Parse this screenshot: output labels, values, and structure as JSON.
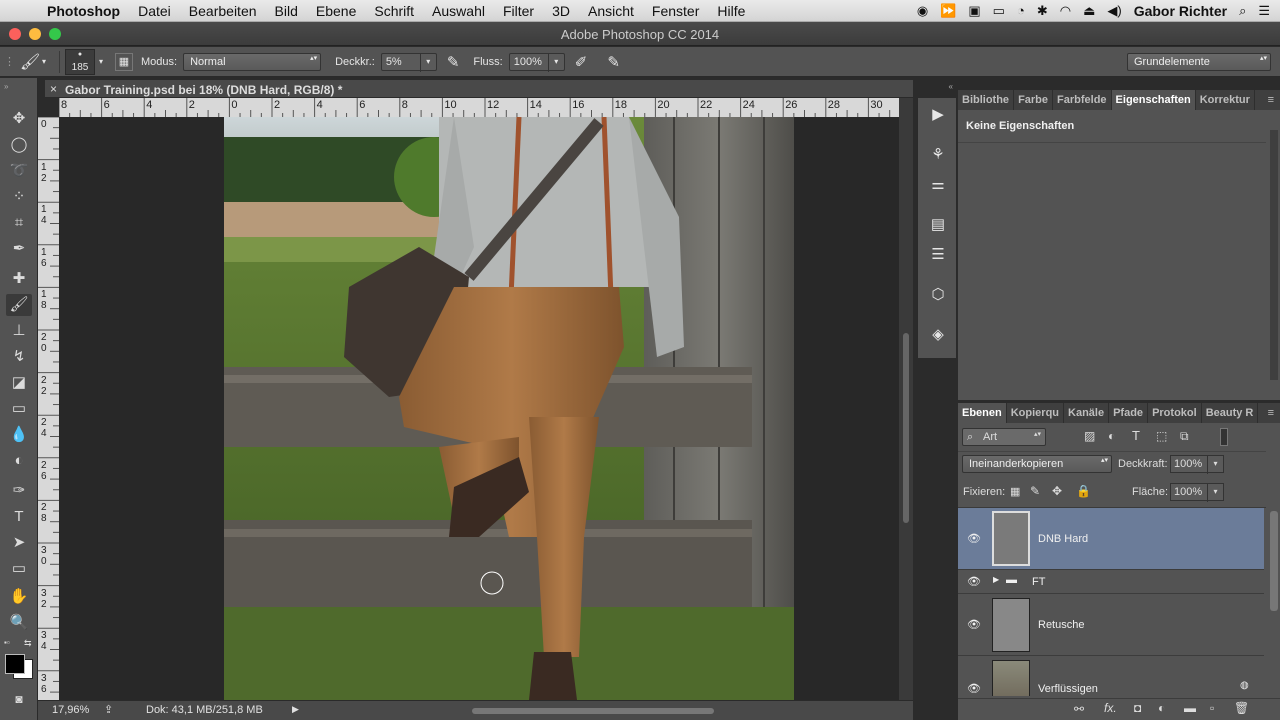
{
  "menubar": {
    "items": [
      "Photoshop",
      "Datei",
      "Bearbeiten",
      "Bild",
      "Ebene",
      "Schrift",
      "Auswahl",
      "Filter",
      "3D",
      "Ansicht",
      "Fenster",
      "Hilfe"
    ],
    "user": "Gabor Richter"
  },
  "window": {
    "title": "Adobe Photoshop CC 2014"
  },
  "options": {
    "brush_size": "185",
    "mode_label": "Modus:",
    "mode_value": "Normal",
    "opacity_label": "Deckkr.:",
    "opacity_value": "5%",
    "flow_label": "Fluss:",
    "flow_value": "100%",
    "workspace": "Grundelemente"
  },
  "document": {
    "tab_title": "Gabor Training.psd bei 18% (DNB Hard, RGB/8) *",
    "close": "×"
  },
  "ruler": {
    "top": [
      "8",
      "6",
      "4",
      "2",
      "0",
      "2",
      "4",
      "6",
      "8",
      "10",
      "12",
      "14",
      "16",
      "18",
      "20",
      "22",
      "24",
      "26",
      "28",
      "30"
    ],
    "left": [
      "0",
      "1\n2",
      "1\n4",
      "1\n6",
      "1\n8",
      "2\n0",
      "2\n2",
      "2\n4",
      "2\n6",
      "2\n8",
      "3\n0",
      "3\n2",
      "3\n4",
      "3\n6"
    ]
  },
  "status": {
    "zoom": "17,96%",
    "doc": "Dok: 43,1 MB/251,8 MB"
  },
  "properties": {
    "tabs": [
      "Bibliothe",
      "Farbe",
      "Farbfelde",
      "Eigenschaften",
      "Korrektur"
    ],
    "active": "Eigenschaften",
    "content": "Keine Eigenschaften"
  },
  "layers": {
    "tabs": [
      "Ebenen",
      "Kopierqu",
      "Kanäle",
      "Pfade",
      "Protokol",
      "Beauty R"
    ],
    "filter": "Art",
    "blend_mode": "Ineinanderkopieren",
    "opacity_label": "Deckkraft:",
    "opacity_value": "100%",
    "lock_label": "Fixieren:",
    "fill_label": "Fläche:",
    "fill_value": "100%",
    "items": [
      {
        "name": "DNB Hard"
      },
      {
        "name": "FT"
      },
      {
        "name": "Retusche"
      },
      {
        "name": "Verflüssigen"
      }
    ]
  },
  "colors": {
    "selected_layer": "#6b7c99",
    "foreground": "#000000",
    "background": "#ffffff"
  }
}
